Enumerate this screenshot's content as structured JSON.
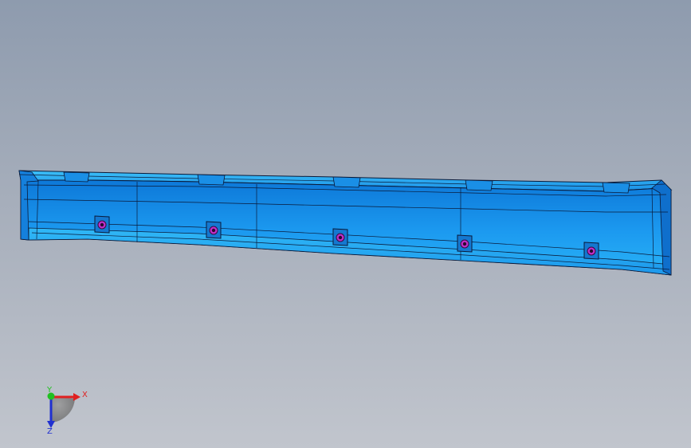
{
  "viewport": {
    "background_top": "#8e9bae",
    "background_bottom": "#c1c5cd"
  },
  "model": {
    "part_color": "#1ea6f2",
    "edge_color": "#0a1a3a",
    "boss_color": "#c030c8",
    "boss_count": 5
  },
  "triad": {
    "x_label": "X",
    "y_label": "Y",
    "z_label": "Z",
    "x_color": "#e02020",
    "y_color": "#20c020",
    "z_color": "#2030d0"
  }
}
